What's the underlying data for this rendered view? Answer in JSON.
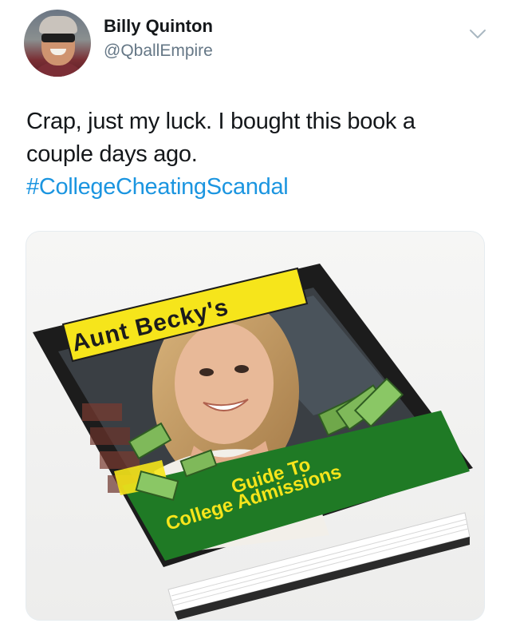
{
  "author": {
    "display_name": "Billy Quinton",
    "handle": "@QballEmpire",
    "avatar_icon": "profile-photo"
  },
  "menu_icon": "chevron-down-icon",
  "tweet": {
    "text_line1": "Crap, just my luck.  I bought this book a",
    "text_line2": "couple days ago.",
    "hashtag": "#CollegeCheatingScandal"
  },
  "media": {
    "book_title_top": "Aunt Becky's",
    "book_subtitle_line1": "Guide To",
    "book_subtitle_line2": "College Admissions"
  },
  "colors": {
    "text_primary": "#14171a",
    "text_secondary": "#657786",
    "link": "#1b95e0",
    "banner_yellow": "#f6e51b",
    "banner_green": "#1f7a25"
  }
}
